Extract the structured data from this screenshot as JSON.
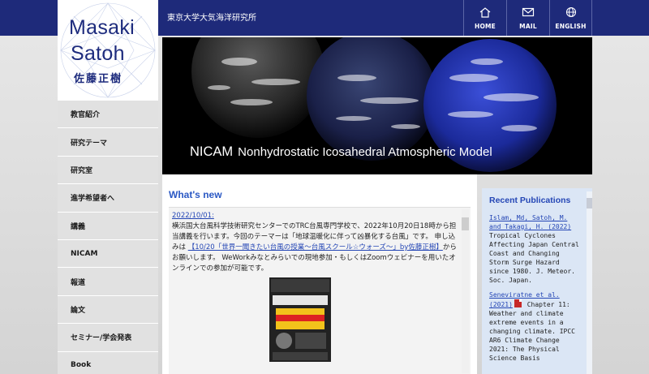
{
  "header": {
    "university": "東京大学大気海洋研究所",
    "nav": [
      {
        "label": "HOME",
        "icon": "home-icon"
      },
      {
        "label": "MAIL",
        "icon": "mail-icon"
      },
      {
        "label": "ENGLISH",
        "icon": "globe-icon"
      }
    ]
  },
  "logo": {
    "line1": "Masaki",
    "line2": "Satoh",
    "kanji": "佐藤正樹"
  },
  "sidebar": {
    "items": [
      {
        "label": "教官紹介"
      },
      {
        "label": "研究テーマ"
      },
      {
        "label": "研究室"
      },
      {
        "label": "進学希望者へ"
      },
      {
        "label": "講義"
      },
      {
        "label": "NICAM"
      },
      {
        "label": "報道"
      },
      {
        "label": "論文"
      },
      {
        "label": "セミナー/学会発表"
      },
      {
        "label": "Book"
      }
    ]
  },
  "hero": {
    "title": "NICAM",
    "subtitle": "Nonhydrostatic Icosahedral Atmospheric Model"
  },
  "whats_new": {
    "title": "What's new",
    "item": {
      "date": "2022/10/01:",
      "text1": "横浜国大台風科学技術研究センターでのTRC台風専門学校で、2022年10月20日18時から担当講義を行います。今回のテーマーは「地球温暖化に伴って凶暴化する台風」です。 申し込みは",
      "link": "【10/20「世界一聞きたい台風の授業～台風スクール☆ウォーズ～」by佐藤正樹】",
      "text2": "からお願いします。 WeWorkみなとみらいでの現地参加・もしくはZoomウェビナーを用いたオンラインでの参加が可能です。"
    }
  },
  "publications": {
    "title": "Recent Publications",
    "entries": [
      {
        "authors": "Islam, Md, Satoh, M. and Takagi, H. (2022)",
        "text": "Tropical Cyclones Affecting Japan Central Coast and Changing Storm Surge Hazard since 1980. J. Meteor. Soc. Japan."
      },
      {
        "authors": "Seneviratne et al. (2021)",
        "text": "Chapter 11: Weather and climate extreme events in a changing climate. IPCC AR6 Climate Change 2021: The Physical Science Basis"
      }
    ]
  },
  "colors": {
    "navy": "#1e2a7a",
    "link": "#2446b5",
    "pubs_bg": "#dbe6f5"
  }
}
